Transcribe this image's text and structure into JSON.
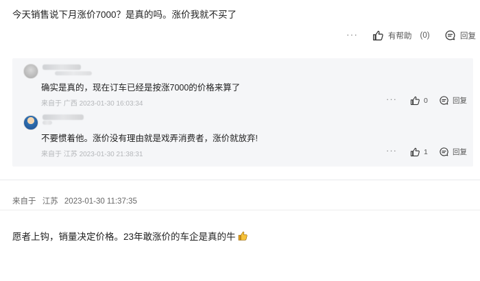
{
  "question": {
    "text": "今天销售说下月涨价7000？是真的吗。涨价我就不买了",
    "more_label": "···",
    "helpful_label": "有帮助",
    "helpful_count": "(0)",
    "reply_label": "回复"
  },
  "replies": [
    {
      "text": "确实是真的，现在订车已经是按涨7000的价格来算了",
      "origin_prefix": "来自于",
      "region": "广西",
      "datetime": "2023-01-30 16:03:34",
      "more_label": "···",
      "like_count": "0",
      "reply_label": "回复"
    },
    {
      "text": "不要惯着他。涨价没有理由就是戏弄消费者，涨价就放弃!",
      "origin_prefix": "来自于",
      "region": "江苏",
      "datetime": "2023-01-30 21:38:31",
      "more_label": "···",
      "like_count": "1",
      "reply_label": "回复"
    }
  ],
  "answer": {
    "origin_prefix": "来自于",
    "region": "江苏",
    "datetime": "2023-01-30 11:37:35",
    "text": "愿者上钩，销量决定价格。23年敢涨价的车企是真的牛"
  },
  "icons": {
    "helpful": "thumbs-up-icon",
    "reply": "comment-icon",
    "emoji": "thumbs-up-emoji-icon"
  },
  "colors": {
    "reply_bg": "#f5f6f8",
    "meta": "#b4b6b9"
  }
}
